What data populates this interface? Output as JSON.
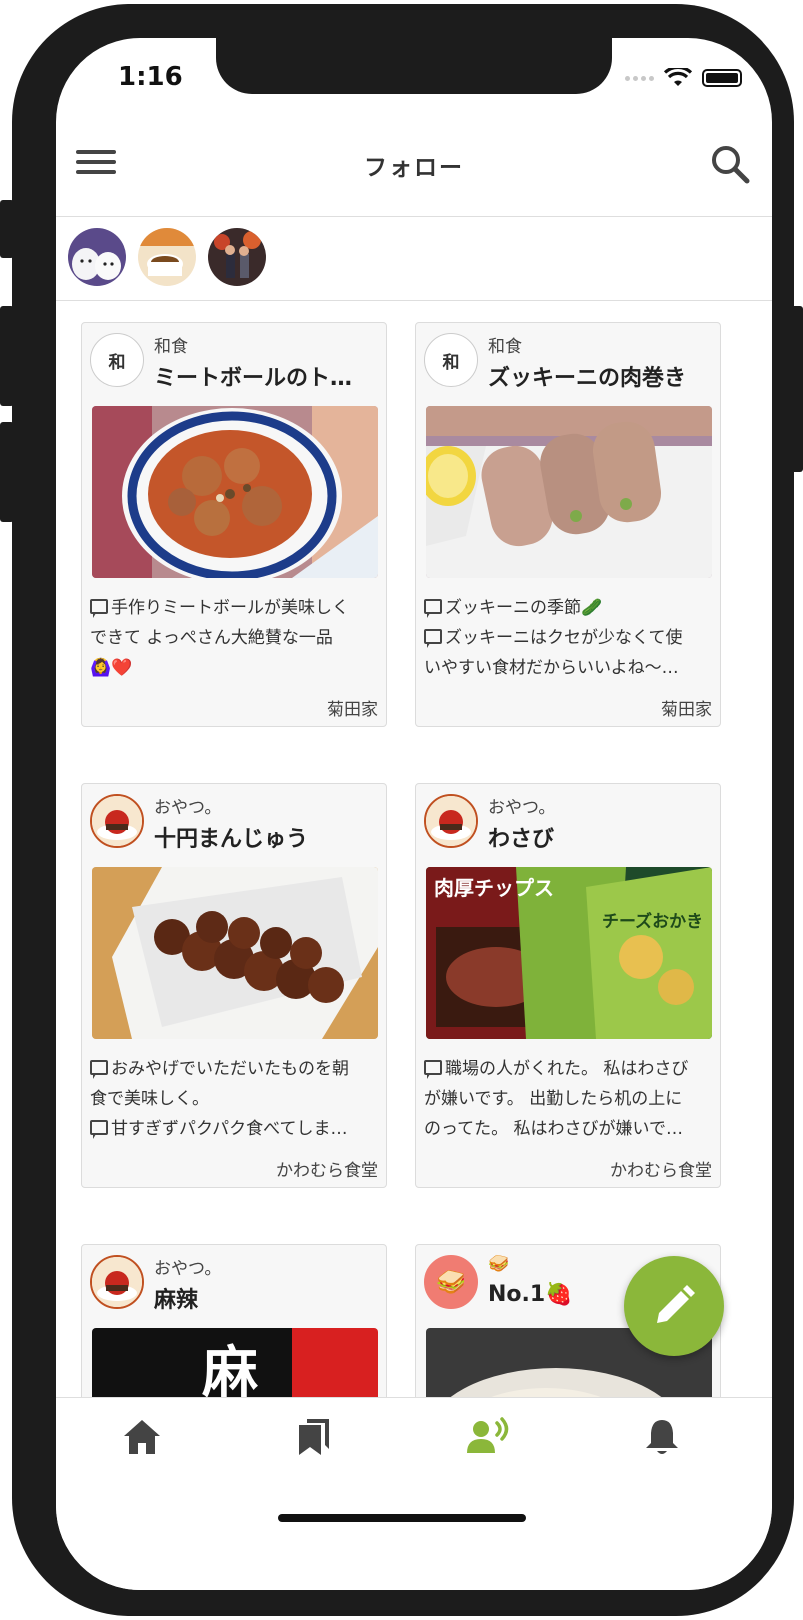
{
  "status_bar": {
    "time": "1:16"
  },
  "header": {
    "title": "フォロー"
  },
  "stories": [
    {
      "name": "story-avatar-1"
    },
    {
      "name": "story-avatar-2"
    },
    {
      "name": "story-avatar-3"
    }
  ],
  "cards": [
    {
      "avatar_text": "和",
      "category": "和食",
      "title": "ミートボールのト…",
      "lines": [
        "手作りミートボールが美味しく",
        "できて よっぺさん大絶賛な一品",
        "🙆‍♀️❤️"
      ],
      "comment_flags": [
        true,
        false,
        false
      ],
      "author": "菊田家"
    },
    {
      "avatar_text": "和",
      "category": "和食",
      "title": "ズッキーニの肉巻き",
      "lines": [
        "ズッキーニの季節🥒",
        "ズッキーニはクセが少なくて使",
        "いやすい食材だからいいよね〜…"
      ],
      "comment_flags": [
        true,
        true,
        false
      ],
      "author": "菊田家"
    },
    {
      "avatar_text": "",
      "category": "おやつ。",
      "title": "十円まんじゅう",
      "lines": [
        "おみやげでいただいたものを朝",
        "食で美味しく。",
        "甘すぎずパクパク食べてしま…"
      ],
      "comment_flags": [
        true,
        false,
        true
      ],
      "author": "かわむら食堂"
    },
    {
      "avatar_text": "",
      "category": "おやつ。",
      "title": "わさび",
      "lines": [
        "職場の人がくれた。 私はわさび",
        "が嫌いです。 出勤したら机の上に",
        "のってた。 私はわさびが嫌いで…"
      ],
      "comment_flags": [
        true,
        false,
        false
      ],
      "author": "かわむら食堂"
    },
    {
      "avatar_text": "",
      "category": "おやつ。",
      "title": "麻辣",
      "lines": [],
      "comment_flags": [],
      "author": ""
    },
    {
      "avatar_text": "🥪",
      "category": "🥪",
      "title": "No.1🍓",
      "lines": [],
      "comment_flags": [],
      "author": ""
    }
  ],
  "photo_texts": {
    "wasabi_left": "肉厚チップス",
    "wasabi_right": "チーズおかき",
    "mala": "麻"
  },
  "tabbar": {
    "items": [
      {
        "icon": "home-icon"
      },
      {
        "icon": "bookmarks-icon"
      },
      {
        "icon": "follow-icon",
        "active": true
      },
      {
        "icon": "bell-icon"
      }
    ]
  },
  "colors": {
    "accent": "#8bb73a",
    "icon": "#444444"
  }
}
